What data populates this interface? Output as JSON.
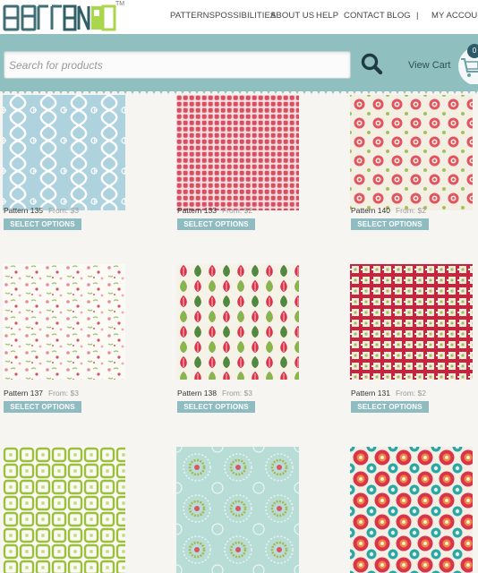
{
  "brand": {
    "logo_text": "PatternPod",
    "trademark": "TM"
  },
  "nav": [
    "PATTERNS",
    "POSSIBILITIES",
    "ABOUT US",
    "HELP",
    "CONTACT",
    "BLOG",
    "|",
    "MY ACCOUNT"
  ],
  "search": {
    "placeholder": "Search for products",
    "value": ""
  },
  "cart": {
    "label": "View Cart",
    "count": "0"
  },
  "products": [
    {
      "name": "Pattern 135",
      "from_label": "From:",
      "price": "$3",
      "button": "SELECT OPTIONS"
    },
    {
      "name": "Pattern 133",
      "from_label": "From:",
      "price": "$2",
      "button": "SELECT OPTIONS"
    },
    {
      "name": "Pattern 140",
      "from_label": "From:",
      "price": "$2",
      "button": "SELECT OPTIONS"
    },
    {
      "name": "Pattern 137",
      "from_label": "From:",
      "price": "$3",
      "button": "SELECT OPTIONS"
    },
    {
      "name": "Pattern 138",
      "from_label": "From:",
      "price": "$3",
      "button": "SELECT OPTIONS"
    },
    {
      "name": "Pattern 131",
      "from_label": "From:",
      "price": "$2",
      "button": "SELECT OPTIONS"
    },
    {
      "name": "",
      "from_label": "",
      "price": "",
      "button": ""
    },
    {
      "name": "",
      "from_label": "",
      "price": "",
      "button": ""
    },
    {
      "name": "",
      "from_label": "",
      "price": "",
      "button": ""
    }
  ],
  "colors": {
    "accent_teal": "#8fbfbf",
    "button": "#8fbcc0",
    "page_bg": "#f6f5f1"
  }
}
